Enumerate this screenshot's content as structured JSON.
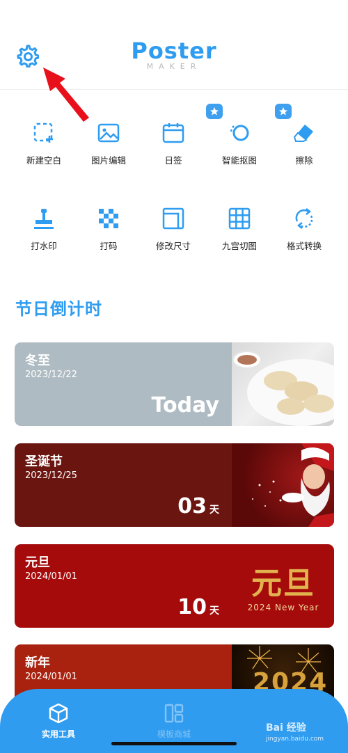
{
  "header": {
    "logo_main": "Poster",
    "logo_sub": "MAKER",
    "settings_icon": "gear-icon"
  },
  "tools": [
    {
      "label": "新建空白",
      "icon": "new-blank-icon",
      "starred": false
    },
    {
      "label": "图片编辑",
      "icon": "image-edit-icon",
      "starred": false
    },
    {
      "label": "日签",
      "icon": "calendar-icon",
      "starred": false
    },
    {
      "label": "智能抠图",
      "icon": "cutout-icon",
      "starred": true
    },
    {
      "label": "擦除",
      "icon": "eraser-icon",
      "starred": true
    },
    {
      "label": "打水印",
      "icon": "stamp-icon",
      "starred": false
    },
    {
      "label": "打码",
      "icon": "mosaic-icon",
      "starred": false
    },
    {
      "label": "修改尺寸",
      "icon": "resize-icon",
      "starred": false
    },
    {
      "label": "九宫切图",
      "icon": "grid-icon",
      "starred": false
    },
    {
      "label": "格式转换",
      "icon": "convert-icon",
      "starred": false
    }
  ],
  "countdown": {
    "title": "节日倒计时",
    "cards": [
      {
        "name": "冬至",
        "date": "2023/12/22",
        "today_text": "Today",
        "color": "#aebbc2"
      },
      {
        "name": "圣诞节",
        "date": "2023/12/25",
        "days": "03",
        "unit": "天",
        "color": "#6b1510"
      },
      {
        "name": "元旦",
        "date": "2024/01/01",
        "days": "10",
        "unit": "天",
        "color": "#a50b0b",
        "image_text": "元旦",
        "image_sub": "2024 New Year"
      },
      {
        "name": "新年",
        "date": "2024/01/01",
        "color": "#a8220f",
        "image_text": "2024"
      }
    ]
  },
  "tabbar": {
    "tabs": [
      {
        "label": "实用工具",
        "icon": "cube-icon",
        "active": true
      },
      {
        "label": "模板商城",
        "icon": "template-icon",
        "active": false
      }
    ]
  },
  "watermark": {
    "text": "Bai 经验",
    "sub": "jingyan.baidu.com"
  },
  "colors": {
    "accent": "#2e9cf0",
    "arrow": "#e8101a"
  }
}
